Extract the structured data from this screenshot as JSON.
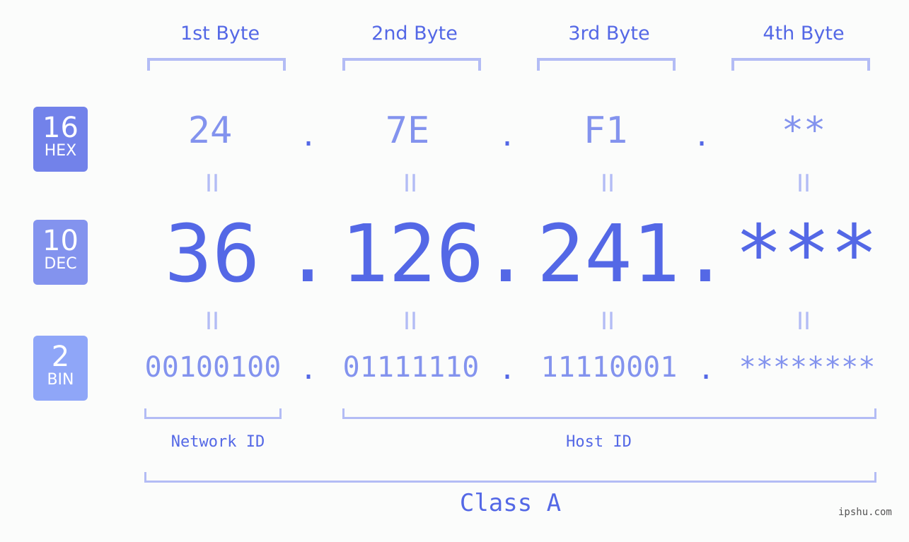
{
  "headers": [
    "1st Byte",
    "2nd Byte",
    "3rd Byte",
    "4th Byte"
  ],
  "badges": [
    {
      "num": "16",
      "label": "HEX",
      "color": "#7282ea"
    },
    {
      "num": "10",
      "label": "DEC",
      "color": "#8393ee"
    },
    {
      "num": "2",
      "label": "BIN",
      "color": "#8fa6f8"
    }
  ],
  "hex": [
    "24",
    "7E",
    "F1",
    "**"
  ],
  "dec": [
    "36",
    "126",
    "241",
    "***"
  ],
  "bin": [
    "00100100",
    "01111110",
    "11110001",
    "********"
  ],
  "separator": ".",
  "equals": "II",
  "network_id_label": "Network ID",
  "host_id_label": "Host ID",
  "class_label": "Class A",
  "watermark": "ipshu.com",
  "colors": {
    "primary": "#5468e6",
    "secondary": "#8393ee",
    "bracket": "#b3bcf5"
  }
}
